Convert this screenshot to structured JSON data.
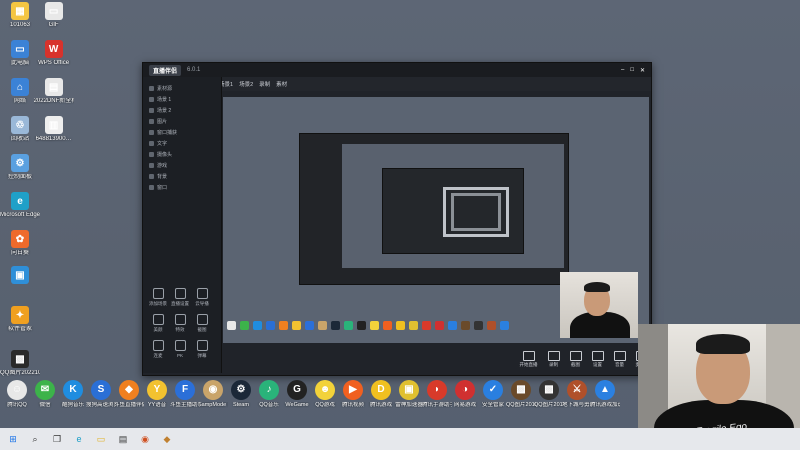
{
  "desktop_icons": [
    {
      "label": "101063",
      "color": "#f4c542",
      "glyph": "▦",
      "icon": "folder-icon"
    },
    {
      "label": "GIF",
      "color": "#e8e8e8",
      "glyph": "▭",
      "icon": "file-icon"
    },
    {
      "label": "此电脑",
      "color": "#3b82d6",
      "glyph": "▭",
      "icon": "computer-icon"
    },
    {
      "label": "WPS Office",
      "color": "#d8322c",
      "glyph": "W",
      "icon": "wps-icon"
    },
    {
      "label": "网络",
      "color": "#3b82d6",
      "glyph": "⌂",
      "icon": "network-icon"
    },
    {
      "label": "2022DNF新全称鼻屎…",
      "color": "#e8e8e8",
      "glyph": "▤",
      "icon": "document-icon"
    },
    {
      "label": "回收站",
      "color": "#9ab8d8",
      "glyph": "♲",
      "icon": "recycle-bin-icon"
    },
    {
      "label": "648813900…",
      "color": "#eeeeee",
      "glyph": "▥",
      "icon": "archive-icon"
    },
    {
      "label": "控制面板",
      "color": "#5aa0e0",
      "glyph": "⚙",
      "icon": "control-panel-icon"
    },
    {
      "label": "Microsoft Edge",
      "color": "#1fa0c8",
      "glyph": "e",
      "icon": "edge-icon"
    },
    {
      "label": "向日葵",
      "color": "#ee6a2c",
      "glyph": "✿",
      "icon": "sunflower-icon"
    },
    {
      "label": "",
      "color": "#2f8fd8",
      "glyph": "▣",
      "icon": "app-icon"
    },
    {
      "label": "软件管家",
      "color": "#f0a020",
      "glyph": "✦",
      "icon": "software-manager-icon"
    },
    {
      "label": "QQ图片20221020…",
      "color": "#2a2a2a",
      "glyph": "▩",
      "icon": "image-icon"
    }
  ],
  "shortcut_row": [
    {
      "label": "腾讯QQ",
      "color": "#e8e8e8",
      "glyph": "☺",
      "icon": "qq-icon"
    },
    {
      "label": "微信",
      "color": "#3cb34a",
      "glyph": "✉",
      "icon": "wechat-icon"
    },
    {
      "label": "酷狗音乐",
      "color": "#1f8de0",
      "glyph": "K",
      "icon": "kugou-icon"
    },
    {
      "label": "搜狗高速浏览器",
      "color": "#2a6fd6",
      "glyph": "S",
      "icon": "sogou-icon"
    },
    {
      "label": "斗鱼直播伴侣",
      "color": "#f08020",
      "glyph": "◆",
      "icon": "douyu-icon"
    },
    {
      "label": "YY语音",
      "color": "#f2c230",
      "glyph": "Y",
      "icon": "yy-icon"
    },
    {
      "label": "斗鱼主播助手",
      "color": "#2b6fd8",
      "glyph": "F",
      "icon": "douyu-helper-icon"
    },
    {
      "label": "SampMode 11",
      "color": "#c9a46a",
      "glyph": "◉",
      "icon": "sampmode-icon"
    },
    {
      "label": "Steam",
      "color": "#1b2838",
      "glyph": "⚙",
      "icon": "steam-icon"
    },
    {
      "label": "QQ音乐",
      "color": "#2ab37a",
      "glyph": "♪",
      "icon": "qq-music-icon"
    },
    {
      "label": "WeGame",
      "color": "#222222",
      "glyph": "G",
      "icon": "wegame-icon"
    },
    {
      "label": "QQ游戏",
      "color": "#f2d23a",
      "glyph": "☻",
      "icon": "qq-game-icon"
    },
    {
      "label": "腾讯视频",
      "color": "#f06020",
      "glyph": "▶",
      "icon": "tencent-video-icon"
    },
    {
      "label": "腾讯游戏",
      "color": "#f0c020",
      "glyph": "D",
      "icon": "tencent-game-icon"
    },
    {
      "label": "雷神加速器",
      "color": "#e0c030",
      "glyph": "▣",
      "icon": "leishen-icon"
    },
    {
      "label": "腾讯手游助手",
      "color": "#d83a2a",
      "glyph": "◗",
      "icon": "mobile-game-icon"
    },
    {
      "label": "网易游戏",
      "color": "#d03030",
      "glyph": "◑",
      "icon": "netease-icon"
    },
    {
      "label": "安全管家",
      "color": "#2a7fe0",
      "glyph": "✓",
      "icon": "security-icon"
    },
    {
      "label": "QQ图片20180515",
      "color": "#6a4a2a",
      "glyph": "▩",
      "icon": "image-icon"
    },
    {
      "label": "QQ图片20170905",
      "color": "#333333",
      "glyph": "▩",
      "icon": "image-icon"
    },
    {
      "label": "地下城与勇士",
      "color": "#b0502a",
      "glyph": "⚔",
      "icon": "dnf-icon"
    },
    {
      "label": "腾讯游戏加速器",
      "color": "#2b80e0",
      "glyph": "▲",
      "icon": "accelerator-icon"
    }
  ],
  "window": {
    "logo": "直播伴侣",
    "version": "6.0.1",
    "tabs": [
      "场景1",
      "场景2",
      "录制",
      "素材"
    ],
    "sidebar": [
      "素材源",
      "场景 1",
      "场景 2",
      "图片",
      "窗口捕获",
      "文字",
      "摄像头",
      "游戏",
      "背景",
      "窗口"
    ],
    "tools": [
      "添加场景",
      "直播设置",
      "云导播",
      "美颜",
      "特效",
      "截图",
      "连麦",
      "PK",
      "弹幕"
    ],
    "controls": [
      "开始直播",
      "录制",
      "截图",
      "设置",
      "音量",
      "麦克风"
    ]
  },
  "taskbar": [
    "start-icon",
    "search-icon",
    "taskview-icon",
    "edge-icon",
    "explorer-icon",
    "store-icon",
    "obs-icon",
    "game-icon"
  ]
}
